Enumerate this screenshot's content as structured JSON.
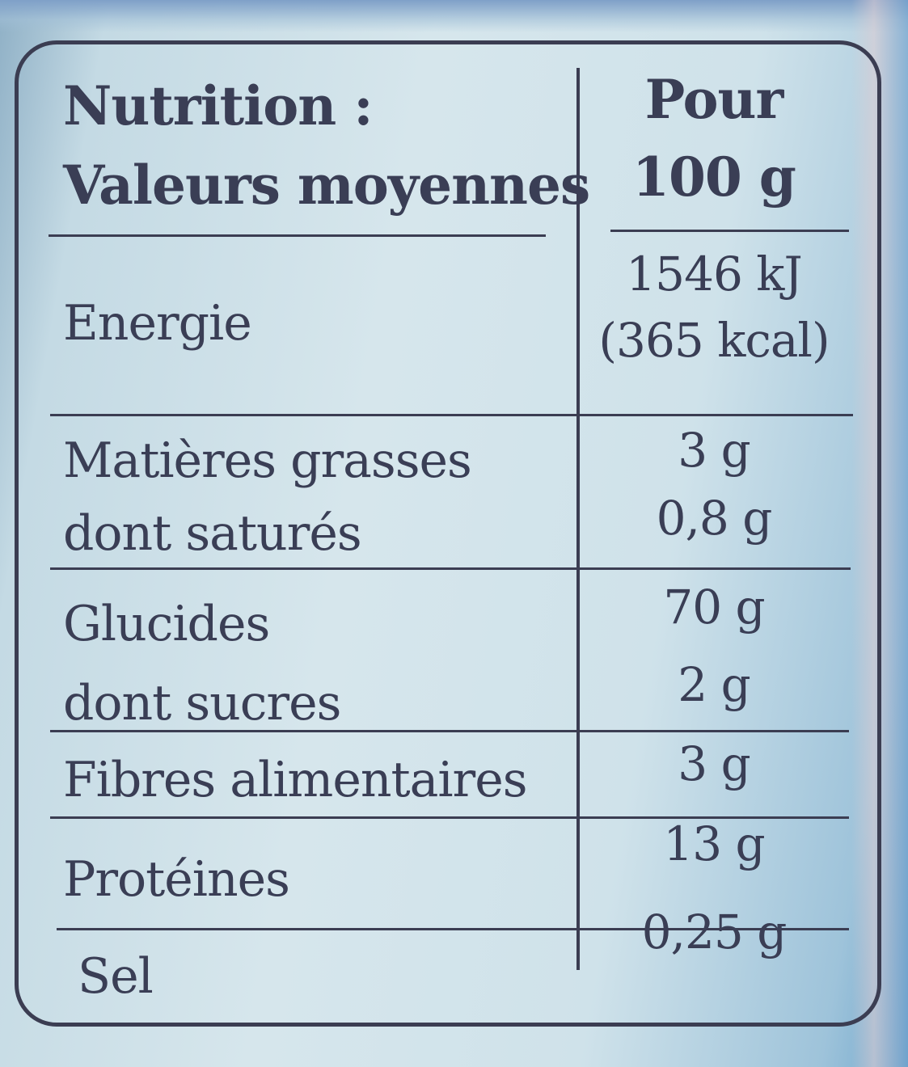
{
  "header": {
    "title_line1": "Nutrition :",
    "title_line2": "Valeurs moyennes",
    "column_line1": "Pour",
    "column_line2": "100 g"
  },
  "rows": [
    {
      "label": "Energie",
      "value_line1": "1546 kJ",
      "value_line2": "(365 kcal)"
    },
    {
      "label": "Matières grasses",
      "value": "3 g"
    },
    {
      "label": "dont saturés",
      "value": "0,8 g"
    },
    {
      "label": "Glucides",
      "value": "70 g"
    },
    {
      "label": "dont sucres",
      "value": "2 g"
    },
    {
      "label": "Fibres alimentaires",
      "value": "3 g"
    },
    {
      "label": "Protéines",
      "value": "13 g"
    },
    {
      "label": "Sel",
      "value": "0,25 g"
    }
  ],
  "colors": {
    "ink": "#3b3d52",
    "background": "#d6e6ec",
    "accent_blue": "#6fa6cc"
  }
}
